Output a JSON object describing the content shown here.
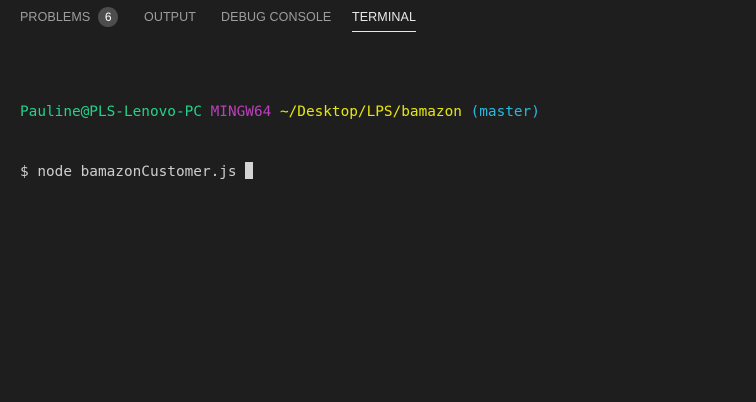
{
  "panel": {
    "tabs": [
      {
        "label": "PROBLEMS",
        "badge": "6"
      },
      {
        "label": "OUTPUT"
      },
      {
        "label": "DEBUG CONSOLE"
      },
      {
        "label": "TERMINAL",
        "active": true
      }
    ]
  },
  "terminal": {
    "prompt": {
      "user_host": "Pauline@PLS-Lenovo-PC",
      "env": "MINGW64",
      "path": "~/Desktop/LPS/bamazon",
      "branch": "(master)"
    },
    "command_line": "$ node bamazonCustomer.js "
  },
  "colors": {
    "background": "#1e1e1e",
    "user_host": "#23d18b",
    "env": "#bc3fbc",
    "path": "#e5e510",
    "branch": "#29b8db",
    "text": "#cccccc"
  }
}
